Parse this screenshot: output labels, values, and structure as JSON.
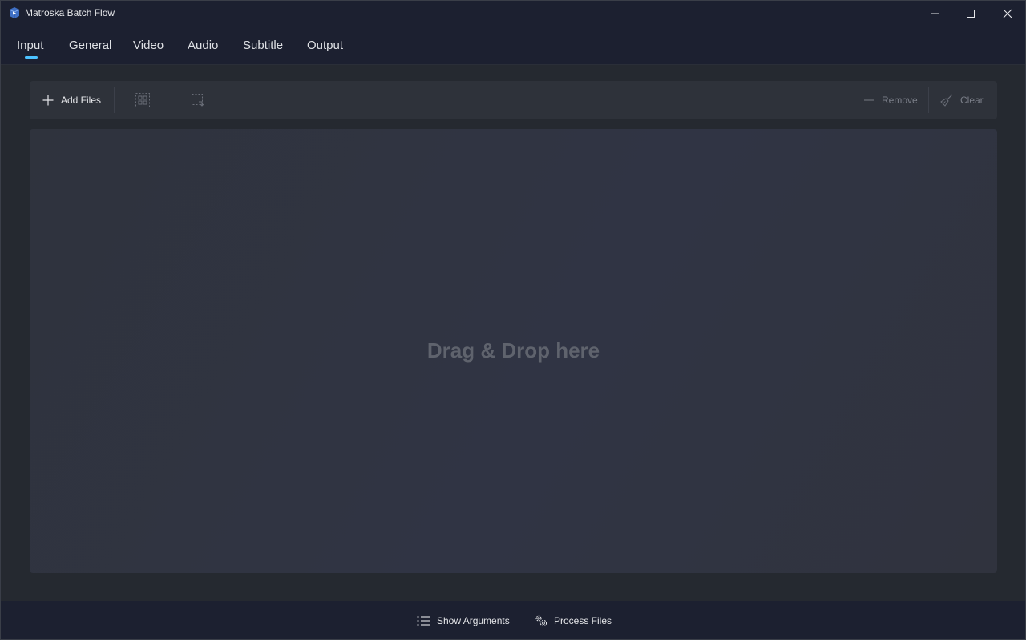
{
  "window": {
    "title": "Matroska Batch Flow"
  },
  "nav": {
    "tabs": [
      {
        "label": "Input",
        "selected": true
      },
      {
        "label": "General"
      },
      {
        "label": "Video"
      },
      {
        "label": "Audio"
      },
      {
        "label": "Subtitle"
      },
      {
        "label": "Output"
      }
    ],
    "accent_color": "#4cc2ff"
  },
  "toolbar": {
    "add_files_label": "Add Files",
    "select_all_icon": "select-all-icon",
    "invert_selection_icon": "invert-selection-icon",
    "remove_label": "Remove",
    "clear_label": "Clear"
  },
  "dropzone": {
    "text": "Drag & Drop here"
  },
  "footer": {
    "show_arguments_label": "Show Arguments",
    "process_files_label": "Process Files"
  }
}
